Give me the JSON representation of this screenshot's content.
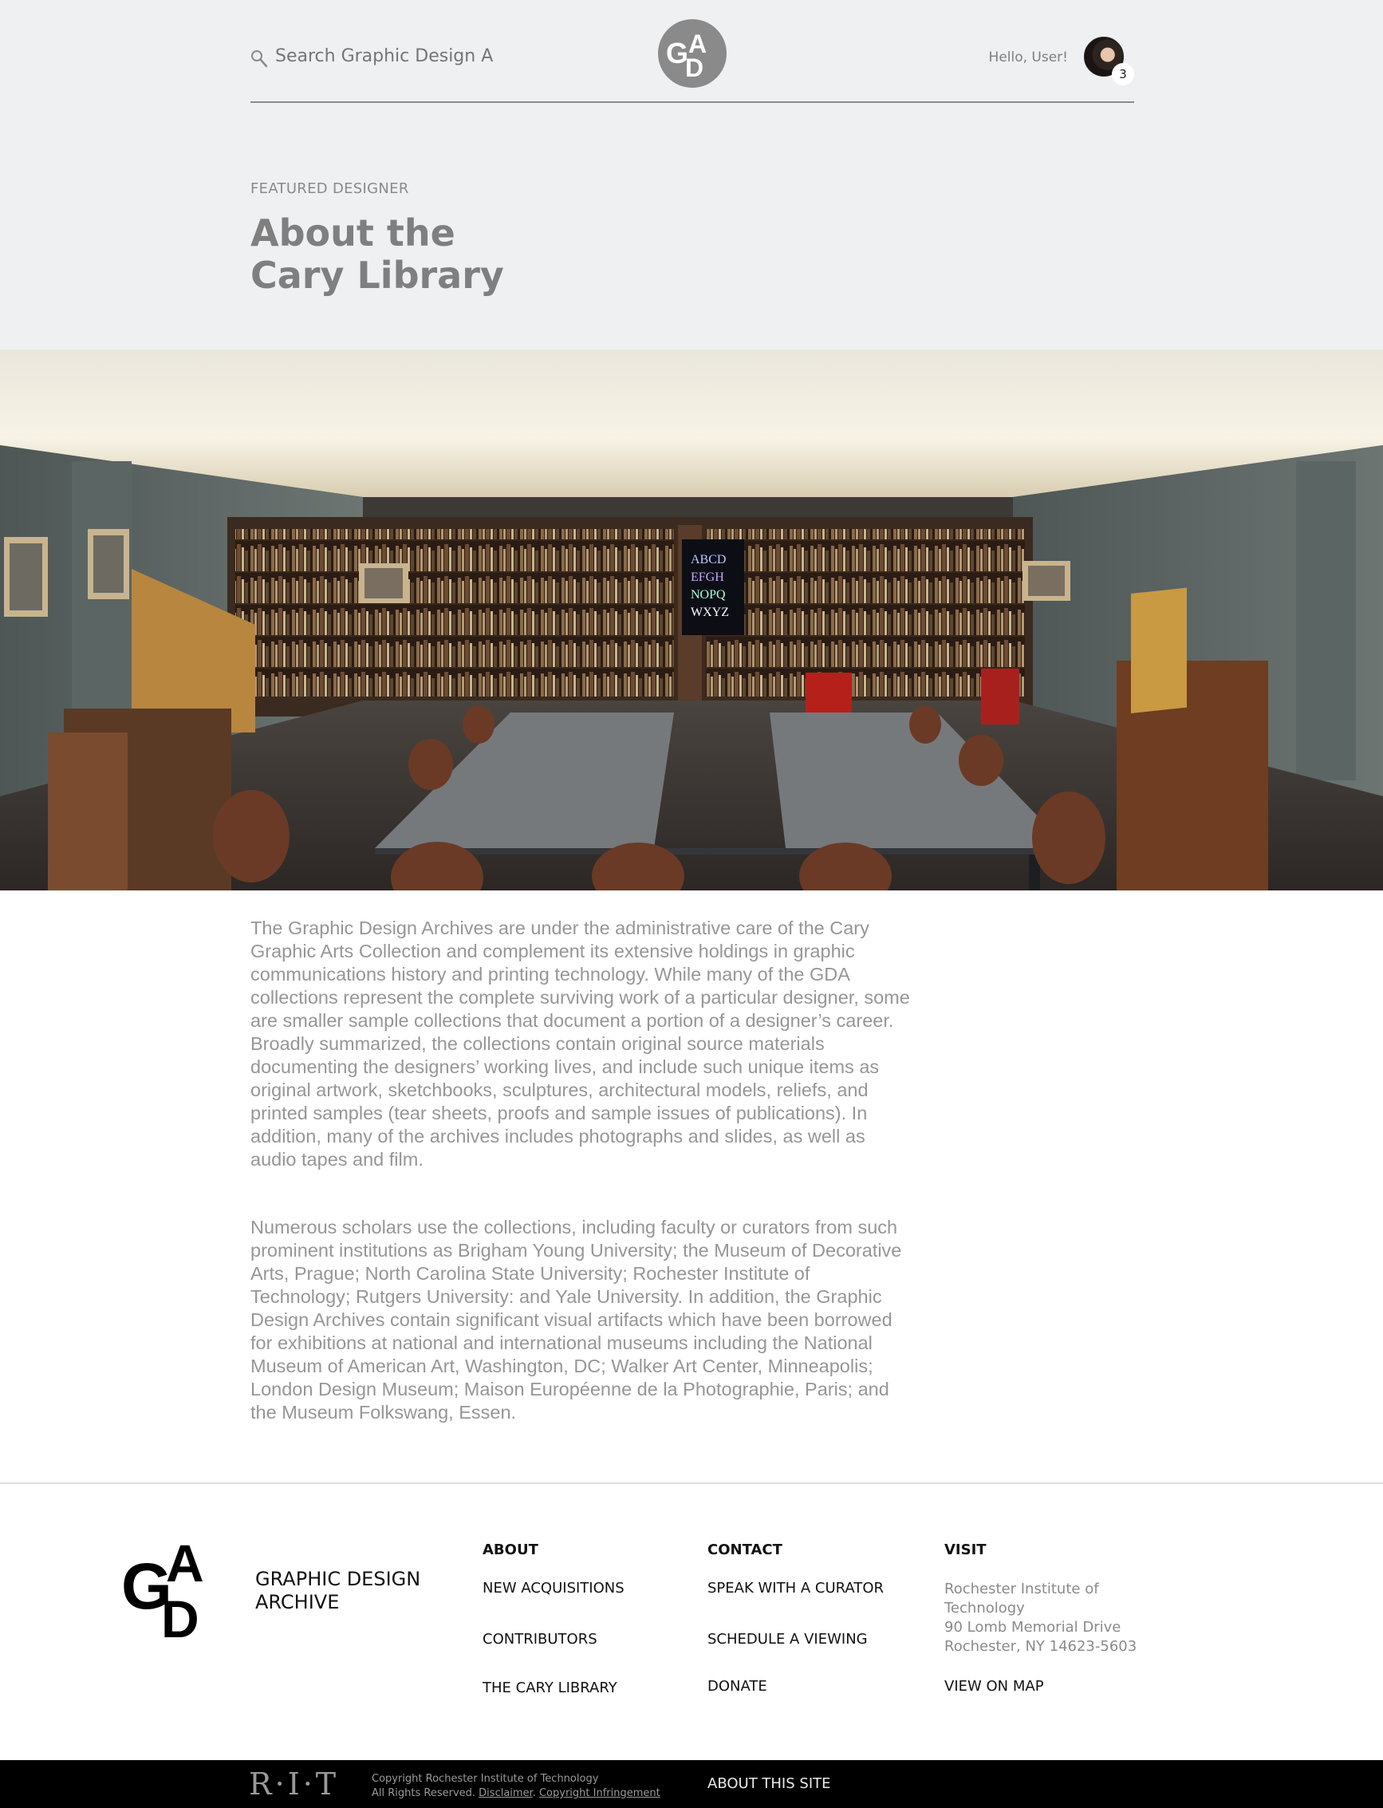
{
  "header": {
    "search_placeholder": "Search Graphic Design Archive",
    "greeting": "Hello, User!",
    "notification_count": "3"
  },
  "hero": {
    "kicker": "FEATURED DESIGNER",
    "title_line1": "About the",
    "title_line2": "Cary Library"
  },
  "content": {
    "paragraph1": "The Graphic Design Archives are under the administrative care of the Cary Graphic Arts Collection and complement its extensive holdings in graphic communications history and printing technology. While many of the GDA collections represent the complete surviving work of a particular designer, some are smaller sample collections that document a portion of a designer’s career. Broadly summarized, the collections contain original source materials documenting the designers’ working lives, and include such unique items as original artwork, sketchbooks, sculptures, architectural models, reliefs, and printed samples (tear sheets, proofs and sample issues of publications). In addition, many of the archives includes photographs and slides, as well as audio tapes and film.",
    "paragraph2": "Numerous scholars use the collections, including faculty or curators from such prominent institutions as Brigham Young University; the Museum of Decorative Arts, Prague; North Carolina State University; Rochester Institute of Technology; Rutgers University: and Yale University. In addition, the Graphic Design Archives contain significant visual artifacts which have been borrowed for exhibitions at national and international museums including the National Museum of American Art, Washington, DC; Walker Art Center, Minneapolis; London Design Museum; Maison Européenne de la Photographie, Paris; and the Museum Folkswang, Essen."
  },
  "footer": {
    "brand_line1": "GRAPHIC DESIGN",
    "brand_line2": "ARCHIVE",
    "about": {
      "heading": "ABOUT",
      "links": [
        "NEW ACQUISITIONS",
        "CONTRIBUTORS",
        "THE CARY LIBRARY"
      ]
    },
    "contact": {
      "heading": "CONTACT",
      "links": [
        "SPEAK WITH A CURATOR",
        "SCHEDULE A VIEWING",
        "DONATE"
      ]
    },
    "visit": {
      "heading": "VISIT",
      "address_line1": "Rochester Institute of",
      "address_line2": "Technology",
      "address_line3": "90 Lomb Memorial Drive",
      "address_line4": "Rochester, NY 14623-5603",
      "map_link": "VIEW ON MAP"
    }
  },
  "bottom_bar": {
    "rit_logo": "R·I·T",
    "copyright_line1": "Copyright Rochester Institute of Technology",
    "copyright_line2_prefix": "All Rights Reserved.",
    "disclaimer": "Disclaimer",
    "infringement": "Copyright Infringement",
    "about_site": "ABOUT THIS SITE"
  }
}
